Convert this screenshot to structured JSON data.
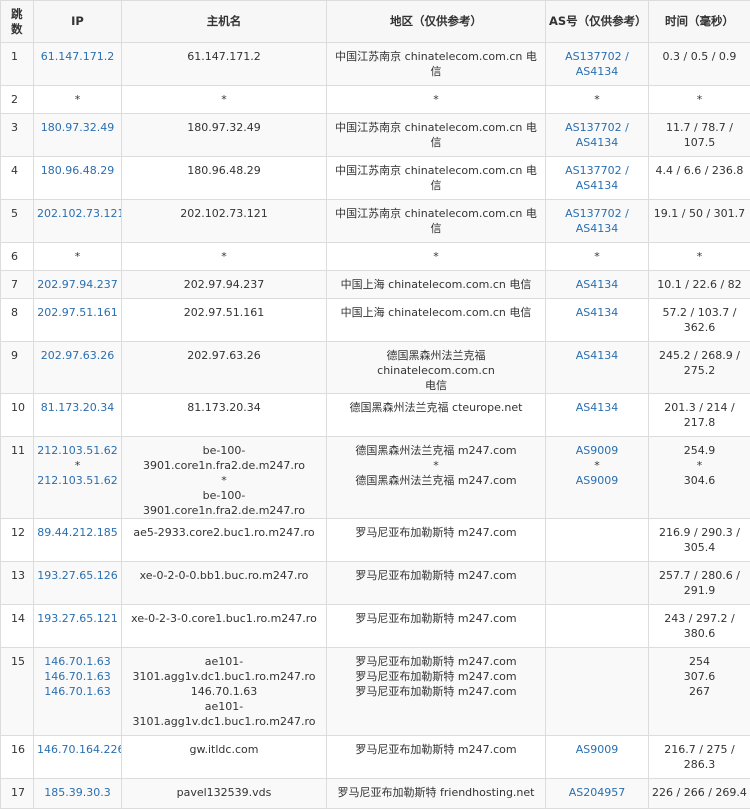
{
  "headers": {
    "hop": "跳数",
    "ip": "IP",
    "host": "主机名",
    "region": "地区（仅供参考）",
    "asn": "AS号（仅供参考）",
    "time": "时间（毫秒）"
  },
  "rows": [
    {
      "hop": "1",
      "ip": [
        "61.147.171.2"
      ],
      "host": [
        "61.147.171.2"
      ],
      "region": [
        "中国江苏南京 chinatelecom.com.cn 电信"
      ],
      "asn": [
        "AS137702 /",
        "AS4134"
      ],
      "time": [
        "0.3 / 0.5 / 0.9"
      ]
    },
    {
      "hop": "2",
      "ip": [
        "*"
      ],
      "host": [
        "*"
      ],
      "region": [
        "*"
      ],
      "asn": [
        "*"
      ],
      "time": [
        "*"
      ]
    },
    {
      "hop": "3",
      "ip": [
        "180.97.32.49"
      ],
      "host": [
        "180.97.32.49"
      ],
      "region": [
        "中国江苏南京 chinatelecom.com.cn 电信"
      ],
      "asn": [
        "AS137702 /",
        "AS4134"
      ],
      "time": [
        "11.7 / 78.7 /",
        "107.5"
      ]
    },
    {
      "hop": "4",
      "ip": [
        "180.96.48.29"
      ],
      "host": [
        "180.96.48.29"
      ],
      "region": [
        "中国江苏南京 chinatelecom.com.cn 电信"
      ],
      "asn": [
        "AS137702 /",
        "AS4134"
      ],
      "time": [
        "4.4 / 6.6 / 236.8"
      ]
    },
    {
      "hop": "5",
      "ip": [
        "202.102.73.121"
      ],
      "host": [
        "202.102.73.121"
      ],
      "region": [
        "中国江苏南京 chinatelecom.com.cn 电信"
      ],
      "asn": [
        "AS137702 /",
        "AS4134"
      ],
      "time": [
        "19.1 / 50 / 301.7"
      ]
    },
    {
      "hop": "6",
      "ip": [
        "*"
      ],
      "host": [
        "*"
      ],
      "region": [
        "*"
      ],
      "asn": [
        "*"
      ],
      "time": [
        "*"
      ]
    },
    {
      "hop": "7",
      "ip": [
        "202.97.94.237"
      ],
      "host": [
        "202.97.94.237"
      ],
      "region": [
        "中国上海 chinatelecom.com.cn 电信"
      ],
      "asn": [
        "AS4134"
      ],
      "time": [
        "10.1 / 22.6 / 82"
      ]
    },
    {
      "hop": "8",
      "ip": [
        "202.97.51.161"
      ],
      "host": [
        "202.97.51.161"
      ],
      "region": [
        "中国上海 chinatelecom.com.cn 电信"
      ],
      "asn": [
        "AS4134"
      ],
      "time": [
        "57.2 / 103.7 /",
        "362.6"
      ]
    },
    {
      "hop": "9",
      "ip": [
        "202.97.63.26"
      ],
      "host": [
        "202.97.63.26"
      ],
      "region": [
        "德国黑森州法兰克福 chinatelecom.com.cn",
        "电信"
      ],
      "asn": [
        "AS4134"
      ],
      "time": [
        "245.2 / 268.9 /",
        "275.2"
      ]
    },
    {
      "hop": "10",
      "ip": [
        "81.173.20.34"
      ],
      "host": [
        "81.173.20.34"
      ],
      "region": [
        "德国黑森州法兰克福 cteurope.net"
      ],
      "asn": [
        "AS4134"
      ],
      "time": [
        "201.3 / 214 /",
        "217.8"
      ]
    },
    {
      "hop": "11",
      "ip": [
        "212.103.51.62",
        "*",
        "212.103.51.62"
      ],
      "host": [
        "be-100-3901.core1n.fra2.de.m247.ro",
        "*",
        "be-100-3901.core1n.fra2.de.m247.ro"
      ],
      "region": [
        "德国黑森州法兰克福 m247.com",
        "*",
        "德国黑森州法兰克福 m247.com"
      ],
      "asn": [
        "AS9009",
        "*",
        "AS9009"
      ],
      "time": [
        "254.9",
        "*",
        "304.6"
      ]
    },
    {
      "hop": "12",
      "ip": [
        "89.44.212.185"
      ],
      "host": [
        "ae5-2933.core2.buc1.ro.m247.ro"
      ],
      "region": [
        "罗马尼亚布加勒斯特 m247.com"
      ],
      "asn": [],
      "time": [
        "216.9 / 290.3 /",
        "305.4"
      ]
    },
    {
      "hop": "13",
      "ip": [
        "193.27.65.126"
      ],
      "host": [
        "xe-0-2-0-0.bb1.buc.ro.m247.ro"
      ],
      "region": [
        "罗马尼亚布加勒斯特 m247.com"
      ],
      "asn": [],
      "time": [
        "257.7 / 280.6 /",
        "291.9"
      ]
    },
    {
      "hop": "14",
      "ip": [
        "193.27.65.121"
      ],
      "host": [
        "xe-0-2-3-0.core1.buc1.ro.m247.ro"
      ],
      "region": [
        "罗马尼亚布加勒斯特 m247.com"
      ],
      "asn": [],
      "time": [
        "243 / 297.2 /",
        "380.6"
      ]
    },
    {
      "hop": "15",
      "ip": [
        "146.70.1.63",
        "146.70.1.63",
        "146.70.1.63"
      ],
      "host": [
        "ae101-",
        "3101.agg1v.dc1.buc1.ro.m247.ro",
        "146.70.1.63",
        "ae101-",
        "3101.agg1v.dc1.buc1.ro.m247.ro"
      ],
      "region": [
        "罗马尼亚布加勒斯特 m247.com",
        "罗马尼亚布加勒斯特 m247.com",
        "罗马尼亚布加勒斯特 m247.com"
      ],
      "asn": [],
      "time": [
        "254",
        "307.6",
        "267"
      ]
    },
    {
      "hop": "16",
      "ip": [
        "146.70.164.226"
      ],
      "host": [
        "gw.itldc.com"
      ],
      "region": [
        "罗马尼亚布加勒斯特 m247.com"
      ],
      "asn": [
        "AS9009"
      ],
      "time": [
        "216.7 / 275 /",
        "286.3"
      ]
    },
    {
      "hop": "17",
      "ip": [
        "185.39.30.3"
      ],
      "host": [
        "pavel132539.vds"
      ],
      "region": [
        "罗马尼亚布加勒斯特 friendhosting.net"
      ],
      "asn": [
        "AS204957"
      ],
      "time": [
        "226 / 266 / 269.4"
      ]
    }
  ]
}
